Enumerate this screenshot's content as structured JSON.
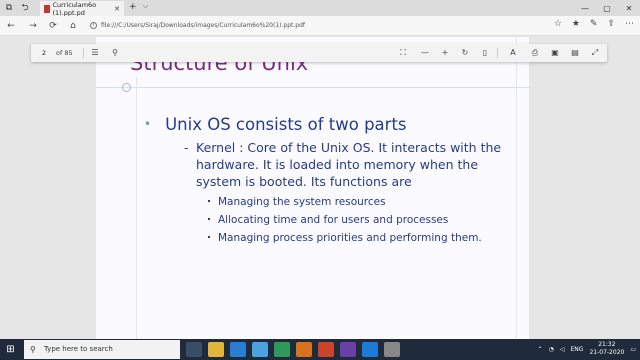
{
  "browser": {
    "tab_title": "Curriculam6o (1).ppt.pd",
    "tab_close": "✕",
    "new_tab": "+",
    "tab_dropdown": "⌵",
    "url": "file:///C:/Users/Siraj/Downloads/images/Curriculam6o%20(1).ppt.pdf",
    "win_min": "—",
    "win_max": "▢",
    "win_close": "✕"
  },
  "pdf_toolbar": {
    "page_current": "2",
    "page_total": "of 85"
  },
  "slide": {
    "title": "Structure of Unix",
    "bullet1": "Unix OS consists of two parts",
    "kernel_dash": "-",
    "kernel_text": "Kernel : Core of the Unix OS. It interacts with the hardware. It is loaded into memory when the system is booted. Its functions are",
    "sub_bullets": [
      "Managing the system resources",
      "Allocating time and for users and processes",
      "Managing process priorities and performing them."
    ]
  },
  "taskbar": {
    "search_placeholder": "Type here to search",
    "time": "21:32",
    "date": "21-07-2020",
    "lang": "ENG"
  },
  "colors": {
    "title": "#7b2e7e",
    "body_text": "#263b87",
    "taskbar": "#1f2a3a"
  }
}
